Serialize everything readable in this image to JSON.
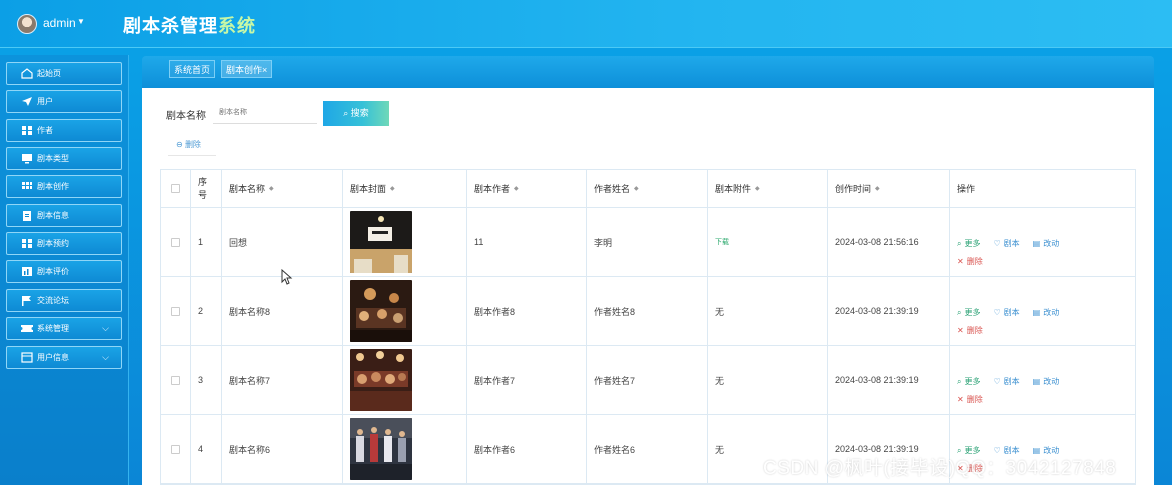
{
  "header": {
    "username": "admin",
    "app_title_main": "剧本杀管理",
    "app_title_highlight": "系统"
  },
  "sidebar": {
    "items": [
      {
        "label": "起始页",
        "icon": "home-icon"
      },
      {
        "label": "用户",
        "icon": "send-icon"
      },
      {
        "label": "作者",
        "icon": "grid-icon"
      },
      {
        "label": "剧本类型",
        "icon": "monitor-icon"
      },
      {
        "label": "剧本创作",
        "icon": "apps-icon"
      },
      {
        "label": "剧本信息",
        "icon": "clipboard-icon"
      },
      {
        "label": "剧本预约",
        "icon": "grid-icon"
      },
      {
        "label": "剧本评价",
        "icon": "chart-icon"
      },
      {
        "label": "交流论坛",
        "icon": "flag-icon"
      },
      {
        "label": "系统管理",
        "icon": "ticket-icon",
        "has_submenu": true
      },
      {
        "label": "用户信息",
        "icon": "panel-icon",
        "has_submenu": true
      }
    ]
  },
  "tabs": {
    "home": "系统首页",
    "active": "剧本创作",
    "close": "×"
  },
  "search": {
    "label": "剧本名称",
    "placeholder": "剧本名称",
    "button": "搜索"
  },
  "toolbar": {
    "delete_label": "删除"
  },
  "table": {
    "headers": {
      "seq": "序号",
      "name": "剧本名称",
      "cover": "剧本封面",
      "author": "剧本作者",
      "author_name": "作者姓名",
      "attachment": "剧本附件",
      "created": "创作时间",
      "ops": "操作"
    },
    "ops_labels": {
      "more": "更多",
      "script": "剧本",
      "edit": "改动",
      "delete": "删除"
    },
    "rows": [
      {
        "seq": "1",
        "name": "回想",
        "author": "11",
        "author_name": "李明",
        "attachment": "下载",
        "created": "2024-03-08 21:56:16"
      },
      {
        "seq": "2",
        "name": "剧本名称8",
        "author": "剧本作者8",
        "author_name": "作者姓名8",
        "attachment": "无",
        "created": "2024-03-08 21:39:19"
      },
      {
        "seq": "3",
        "name": "剧本名称7",
        "author": "剧本作者7",
        "author_name": "作者姓名7",
        "attachment": "无",
        "created": "2024-03-08 21:39:19"
      },
      {
        "seq": "4",
        "name": "剧本名称6",
        "author": "剧本作者6",
        "author_name": "作者姓名6",
        "attachment": "无",
        "created": "2024-03-08 21:39:19"
      }
    ]
  },
  "watermark": "CSDN @枫叶(接毕设)QQ：3042127848",
  "colors": {
    "primary": "#0b9fe6",
    "accent_green": "#29a174",
    "danger": "#d9534f"
  }
}
